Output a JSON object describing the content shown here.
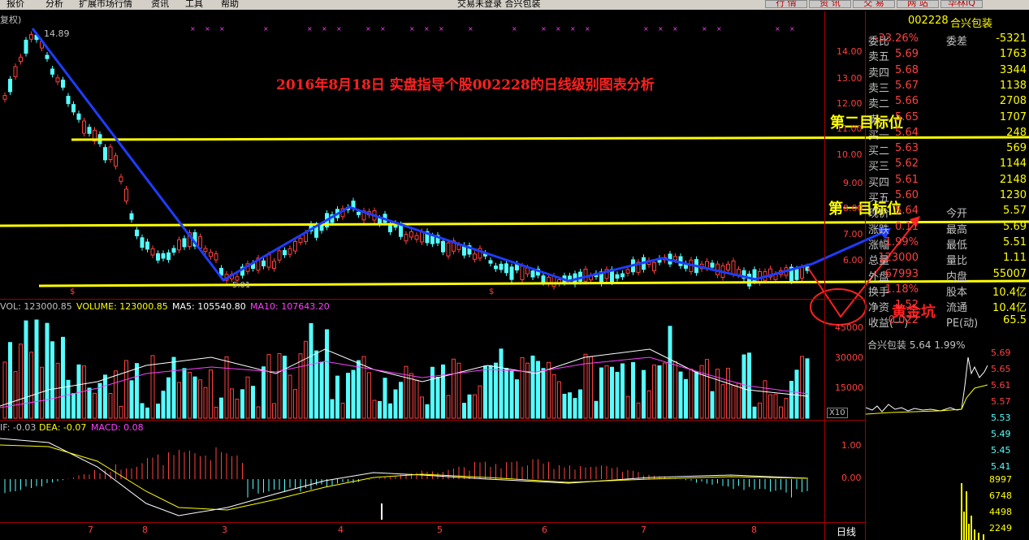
{
  "menubar": {
    "items": [
      "报价",
      "分析",
      "扩展市场行情",
      "资讯",
      "工具",
      "帮助"
    ],
    "center_title": "交易未登录   合兴包装"
  },
  "top_buttons": [
    "行 情",
    "资 讯",
    "交 易",
    "网 站",
    "华林iQ"
  ],
  "chart": {
    "fuquan_label": "复权)",
    "title": "2016年8月18日 实盘指导个股002228的日线级别图表分析",
    "high_label": "14.89",
    "low_label": "5.01",
    "target2": "第二目标位",
    "target1": "第一目标位",
    "golden": "黄金坑",
    "price_ticks": [
      "14.00",
      "13.00",
      "12.00",
      "11.00",
      "10.00",
      "9.00",
      "8.00",
      "7.00",
      "6.00"
    ],
    "dollar_marks": [
      "$",
      "$"
    ],
    "month_labels": [
      "7",
      "8",
      "3",
      "4",
      "5",
      "6",
      "7",
      "8"
    ],
    "period_label": "日线"
  },
  "volume_panel": {
    "vol": "VOL: 123000.85",
    "volume": "VOLUME: 123000.85",
    "ma5": "MA5: 105540.80",
    "ma10": "MA10: 107643.20",
    "ticks": [
      "45000",
      "30000",
      "15000"
    ],
    "scale": "X10"
  },
  "macd_panel": {
    "dif": "IF: -0.03",
    "dea": "DEA: -0.07",
    "macd": "MACD: 0.08",
    "ticks": [
      "1.00",
      "0.00"
    ]
  },
  "quote": {
    "code": "002228",
    "name": "合兴包装",
    "rows": [
      {
        "a": "委比",
        "b": "-33.26%",
        "c": "委差",
        "d": "-5321"
      },
      {
        "a": "卖五",
        "b": "5.69",
        "c": "",
        "d": "1763"
      },
      {
        "a": "卖四",
        "b": "5.68",
        "c": "",
        "d": "3344"
      },
      {
        "a": "卖三",
        "b": "5.67",
        "c": "",
        "d": "1138"
      },
      {
        "a": "卖二",
        "b": "5.66",
        "c": "",
        "d": "2708"
      },
      {
        "a": "卖一",
        "b": "5.65",
        "c": "",
        "d": "1707"
      },
      {
        "a": "买一",
        "b": "5.64",
        "c": "",
        "d": "248"
      },
      {
        "a": "买二",
        "b": "5.63",
        "c": "",
        "d": "569"
      },
      {
        "a": "买三",
        "b": "5.62",
        "c": "",
        "d": "1144"
      },
      {
        "a": "买四",
        "b": "5.61",
        "c": "",
        "d": "2148"
      },
      {
        "a": "买五",
        "b": "5.60",
        "c": "",
        "d": "1230"
      },
      {
        "a": "现价",
        "b": "5.64",
        "c": "今开",
        "d": "5.57"
      },
      {
        "a": "涨跌",
        "b": "0.11",
        "c": "最高",
        "d": "5.69"
      },
      {
        "a": "涨幅",
        "b": "1.99%",
        "c": "最低",
        "d": "5.51"
      },
      {
        "a": "总量",
        "b": "123000",
        "c": "量比",
        "d": "1.11"
      },
      {
        "a": "外盘",
        "b": "67993",
        "c": "内盘",
        "d": "55007"
      },
      {
        "a": "换手",
        "b": "1.18%",
        "c": "股本",
        "d": "10.4亿"
      },
      {
        "a": "净资",
        "b": "1.52",
        "c": "流通",
        "d": "10.4亿"
      },
      {
        "a": "收益(一)",
        "b": "0.022",
        "c": "PE(动)",
        "d": "65.5"
      }
    ],
    "mini_title": "合兴包装  5.64  1.99%",
    "mini_prices": [
      "5.69",
      "5.65",
      "5.61",
      "5.57",
      "5.53",
      "5.49",
      "5.45",
      "5.41"
    ],
    "mini_vols": [
      "8997",
      "6748",
      "4498",
      "2249"
    ]
  },
  "colors": {
    "up": "#ff4040",
    "down": "#54ffff",
    "yellow": "#ffff00",
    "blue": "#1e3cff",
    "magenta": "#ff40ff"
  }
}
